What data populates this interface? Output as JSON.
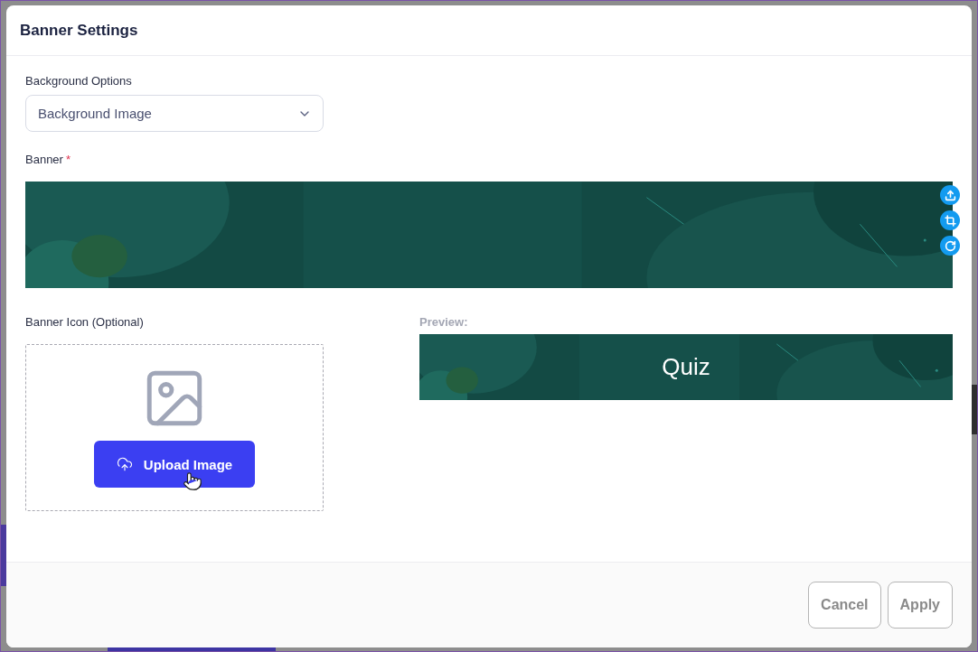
{
  "dialog": {
    "title": "Banner Settings"
  },
  "background_options": {
    "label": "Background Options",
    "value": "Background Image"
  },
  "banner": {
    "label": "Banner",
    "required_mark": "*"
  },
  "banner_icon": {
    "label": "Banner Icon (Optional)",
    "button": "Upload Image"
  },
  "preview": {
    "label": "Preview:",
    "title": "Quiz"
  },
  "footer": {
    "buttons": [
      "Cancel",
      "Apply"
    ]
  }
}
